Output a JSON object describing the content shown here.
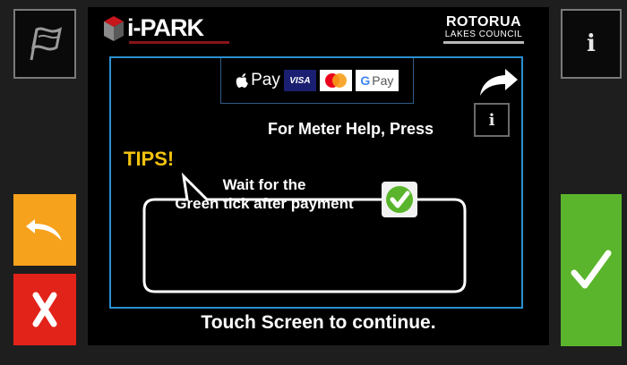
{
  "brand": {
    "logo_text": "i-PARK",
    "council_name": "ROTORUA",
    "council_sub": "LAKES COUNCIL"
  },
  "payments": {
    "apple": "Pay",
    "visa": "VISA",
    "google": "Pay"
  },
  "help": {
    "text": "For Meter Help, Press",
    "button_glyph": "i"
  },
  "tips": {
    "label": "TIPS!",
    "line1": "Wait for the",
    "line2": "Green tick after payment"
  },
  "footer": {
    "continue_text": "Touch Screen to continue."
  },
  "side_buttons": {
    "info_glyph": "i"
  },
  "colors": {
    "panel_border": "#2b8fcf",
    "back_button": "#f6a21c",
    "cancel_button": "#e2231a",
    "ok_button": "#5ab52c",
    "tips_text": "#f3c20f"
  }
}
